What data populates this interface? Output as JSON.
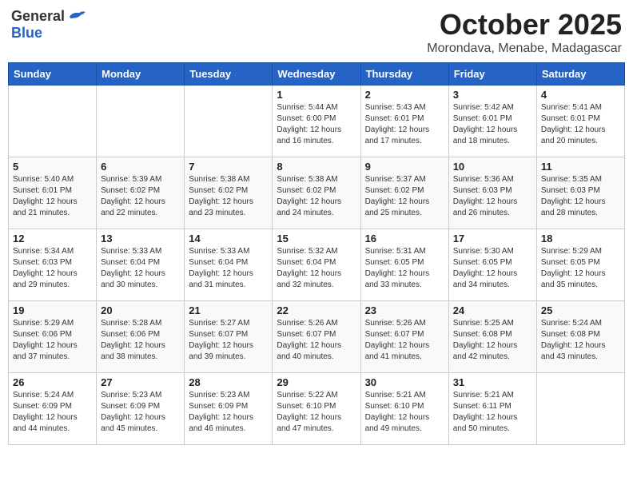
{
  "logo": {
    "general": "General",
    "blue": "Blue"
  },
  "header": {
    "month": "October 2025",
    "location": "Morondava, Menabe, Madagascar"
  },
  "weekdays": [
    "Sunday",
    "Monday",
    "Tuesday",
    "Wednesday",
    "Thursday",
    "Friday",
    "Saturday"
  ],
  "weeks": [
    [
      {
        "day": "",
        "info": ""
      },
      {
        "day": "",
        "info": ""
      },
      {
        "day": "",
        "info": ""
      },
      {
        "day": "1",
        "info": "Sunrise: 5:44 AM\nSunset: 6:00 PM\nDaylight: 12 hours\nand 16 minutes."
      },
      {
        "day": "2",
        "info": "Sunrise: 5:43 AM\nSunset: 6:01 PM\nDaylight: 12 hours\nand 17 minutes."
      },
      {
        "day": "3",
        "info": "Sunrise: 5:42 AM\nSunset: 6:01 PM\nDaylight: 12 hours\nand 18 minutes."
      },
      {
        "day": "4",
        "info": "Sunrise: 5:41 AM\nSunset: 6:01 PM\nDaylight: 12 hours\nand 20 minutes."
      }
    ],
    [
      {
        "day": "5",
        "info": "Sunrise: 5:40 AM\nSunset: 6:01 PM\nDaylight: 12 hours\nand 21 minutes."
      },
      {
        "day": "6",
        "info": "Sunrise: 5:39 AM\nSunset: 6:02 PM\nDaylight: 12 hours\nand 22 minutes."
      },
      {
        "day": "7",
        "info": "Sunrise: 5:38 AM\nSunset: 6:02 PM\nDaylight: 12 hours\nand 23 minutes."
      },
      {
        "day": "8",
        "info": "Sunrise: 5:38 AM\nSunset: 6:02 PM\nDaylight: 12 hours\nand 24 minutes."
      },
      {
        "day": "9",
        "info": "Sunrise: 5:37 AM\nSunset: 6:02 PM\nDaylight: 12 hours\nand 25 minutes."
      },
      {
        "day": "10",
        "info": "Sunrise: 5:36 AM\nSunset: 6:03 PM\nDaylight: 12 hours\nand 26 minutes."
      },
      {
        "day": "11",
        "info": "Sunrise: 5:35 AM\nSunset: 6:03 PM\nDaylight: 12 hours\nand 28 minutes."
      }
    ],
    [
      {
        "day": "12",
        "info": "Sunrise: 5:34 AM\nSunset: 6:03 PM\nDaylight: 12 hours\nand 29 minutes."
      },
      {
        "day": "13",
        "info": "Sunrise: 5:33 AM\nSunset: 6:04 PM\nDaylight: 12 hours\nand 30 minutes."
      },
      {
        "day": "14",
        "info": "Sunrise: 5:33 AM\nSunset: 6:04 PM\nDaylight: 12 hours\nand 31 minutes."
      },
      {
        "day": "15",
        "info": "Sunrise: 5:32 AM\nSunset: 6:04 PM\nDaylight: 12 hours\nand 32 minutes."
      },
      {
        "day": "16",
        "info": "Sunrise: 5:31 AM\nSunset: 6:05 PM\nDaylight: 12 hours\nand 33 minutes."
      },
      {
        "day": "17",
        "info": "Sunrise: 5:30 AM\nSunset: 6:05 PM\nDaylight: 12 hours\nand 34 minutes."
      },
      {
        "day": "18",
        "info": "Sunrise: 5:29 AM\nSunset: 6:05 PM\nDaylight: 12 hours\nand 35 minutes."
      }
    ],
    [
      {
        "day": "19",
        "info": "Sunrise: 5:29 AM\nSunset: 6:06 PM\nDaylight: 12 hours\nand 37 minutes."
      },
      {
        "day": "20",
        "info": "Sunrise: 5:28 AM\nSunset: 6:06 PM\nDaylight: 12 hours\nand 38 minutes."
      },
      {
        "day": "21",
        "info": "Sunrise: 5:27 AM\nSunset: 6:07 PM\nDaylight: 12 hours\nand 39 minutes."
      },
      {
        "day": "22",
        "info": "Sunrise: 5:26 AM\nSunset: 6:07 PM\nDaylight: 12 hours\nand 40 minutes."
      },
      {
        "day": "23",
        "info": "Sunrise: 5:26 AM\nSunset: 6:07 PM\nDaylight: 12 hours\nand 41 minutes."
      },
      {
        "day": "24",
        "info": "Sunrise: 5:25 AM\nSunset: 6:08 PM\nDaylight: 12 hours\nand 42 minutes."
      },
      {
        "day": "25",
        "info": "Sunrise: 5:24 AM\nSunset: 6:08 PM\nDaylight: 12 hours\nand 43 minutes."
      }
    ],
    [
      {
        "day": "26",
        "info": "Sunrise: 5:24 AM\nSunset: 6:09 PM\nDaylight: 12 hours\nand 44 minutes."
      },
      {
        "day": "27",
        "info": "Sunrise: 5:23 AM\nSunset: 6:09 PM\nDaylight: 12 hours\nand 45 minutes."
      },
      {
        "day": "28",
        "info": "Sunrise: 5:23 AM\nSunset: 6:09 PM\nDaylight: 12 hours\nand 46 minutes."
      },
      {
        "day": "29",
        "info": "Sunrise: 5:22 AM\nSunset: 6:10 PM\nDaylight: 12 hours\nand 47 minutes."
      },
      {
        "day": "30",
        "info": "Sunrise: 5:21 AM\nSunset: 6:10 PM\nDaylight: 12 hours\nand 49 minutes."
      },
      {
        "day": "31",
        "info": "Sunrise: 5:21 AM\nSunset: 6:11 PM\nDaylight: 12 hours\nand 50 minutes."
      },
      {
        "day": "",
        "info": ""
      }
    ]
  ]
}
